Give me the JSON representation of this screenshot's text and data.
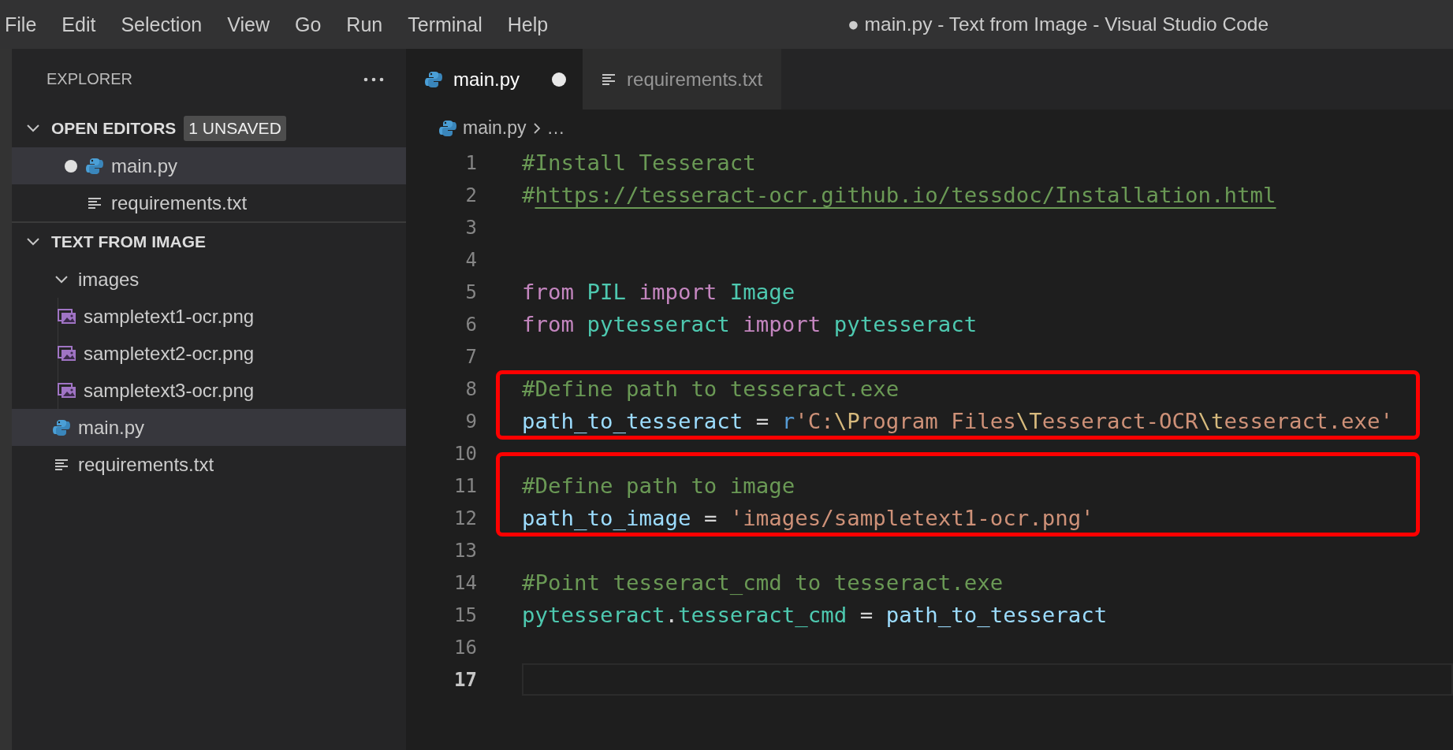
{
  "window": {
    "title": "● main.py - Text from Image - Visual Studio Code"
  },
  "menu": [
    "File",
    "Edit",
    "Selection",
    "View",
    "Go",
    "Run",
    "Terminal",
    "Help"
  ],
  "explorer": {
    "title": "EXPLORER",
    "sections": [
      {
        "title": "OPEN EDITORS",
        "expanded": true,
        "badge": "1 UNSAVED",
        "items": [
          {
            "name": "main.py",
            "kind": "python",
            "dirty": true,
            "selected": true
          },
          {
            "name": "requirements.txt",
            "kind": "text",
            "dirty": false,
            "selected": false
          }
        ]
      },
      {
        "title": "TEXT FROM IMAGE",
        "expanded": true,
        "items": [
          {
            "name": "images",
            "kind": "folder",
            "expanded": true,
            "selected": false,
            "children": [
              {
                "name": "sampletext1-ocr.png",
                "kind": "image",
                "selected": false
              },
              {
                "name": "sampletext2-ocr.png",
                "kind": "image",
                "selected": false
              },
              {
                "name": "sampletext3-ocr.png",
                "kind": "image",
                "selected": false
              }
            ]
          },
          {
            "name": "main.py",
            "kind": "python",
            "selected": true
          },
          {
            "name": "requirements.txt",
            "kind": "text",
            "selected": false
          }
        ]
      }
    ]
  },
  "tabs": [
    {
      "label": "main.py",
      "kind": "python",
      "selected": true,
      "dirty": true
    },
    {
      "label": "requirements.txt",
      "kind": "text",
      "selected": false,
      "dirty": false
    }
  ],
  "breadcrumb": {
    "file": "main.py",
    "kind": "python",
    "rest": "…"
  },
  "editor": {
    "sections": [
      {
        "boxed": false,
        "lines": [
          {
            "number": "1",
            "current": false,
            "tokens": [
              {
                "text": "#Install Tesseract",
                "kind": "comment"
              }
            ]
          },
          {
            "number": "2",
            "current": false,
            "tokens": [
              {
                "text": "#",
                "kind": "comment"
              },
              {
                "text": "https://tesseract-ocr.github.io/tessdoc/Installation.html",
                "kind": "link"
              }
            ]
          },
          {
            "number": "3",
            "current": false
          },
          {
            "number": "4",
            "current": false
          },
          {
            "number": "5",
            "current": false,
            "tokens": [
              {
                "text": "from",
                "kind": "keyword"
              },
              {
                "text": " PIL ",
                "kind": "module"
              },
              {
                "text": "import",
                "kind": "keyword"
              },
              {
                "text": " Image",
                "kind": "class"
              }
            ]
          },
          {
            "number": "6",
            "current": false,
            "tokens": [
              {
                "text": "from",
                "kind": "keyword"
              },
              {
                "text": " pytesseract ",
                "kind": "module"
              },
              {
                "text": "import",
                "kind": "keyword"
              },
              {
                "text": " pytesseract",
                "kind": "module"
              }
            ]
          },
          {
            "number": "7",
            "current": false
          }
        ]
      },
      {
        "boxed": true,
        "lines": [
          {
            "number": "8",
            "current": false,
            "tokens": [
              {
                "text": "#Define path to tesseract.exe",
                "kind": "comment"
              }
            ]
          },
          {
            "number": "9",
            "current": false,
            "tokens": [
              {
                "text": "path_to_tesseract",
                "kind": "variable"
              },
              {
                "text": " = ",
                "kind": "plain"
              },
              {
                "text": "r",
                "kind": "prefix"
              },
              {
                "text": "'C:",
                "kind": "string"
              },
              {
                "text": "\\P",
                "kind": "escape"
              },
              {
                "text": "rogram Files",
                "kind": "string"
              },
              {
                "text": "\\T",
                "kind": "escape"
              },
              {
                "text": "esseract-OCR",
                "kind": "string"
              },
              {
                "text": "\\t",
                "kind": "escape"
              },
              {
                "text": "esseract.exe'",
                "kind": "string"
              }
            ]
          }
        ]
      },
      {
        "boxed": false,
        "lines": [
          {
            "number": "10",
            "current": false
          }
        ]
      },
      {
        "boxed": true,
        "lines": [
          {
            "number": "11",
            "current": false,
            "tokens": [
              {
                "text": "#Define path to image",
                "kind": "comment"
              }
            ]
          },
          {
            "number": "12",
            "current": false,
            "tokens": [
              {
                "text": "path_to_image",
                "kind": "variable"
              },
              {
                "text": " = ",
                "kind": "plain"
              },
              {
                "text": "'images/sampletext1-ocr.png'",
                "kind": "string"
              }
            ]
          }
        ]
      },
      {
        "boxed": false,
        "lines": [
          {
            "number": "13",
            "current": false
          },
          {
            "number": "14",
            "current": false,
            "tokens": [
              {
                "text": "#Point tesseract_cmd to tesseract.exe",
                "kind": "comment"
              }
            ]
          },
          {
            "number": "15",
            "current": false,
            "tokens": [
              {
                "text": "pytesseract",
                "kind": "module"
              },
              {
                "text": ".",
                "kind": "plain"
              },
              {
                "text": "tesseract_cmd",
                "kind": "module"
              },
              {
                "text": " = ",
                "kind": "plain"
              },
              {
                "text": "path_to_tesseract",
                "kind": "variable"
              }
            ]
          },
          {
            "number": "16",
            "current": false
          },
          {
            "number": "17",
            "current": true
          }
        ]
      }
    ]
  }
}
